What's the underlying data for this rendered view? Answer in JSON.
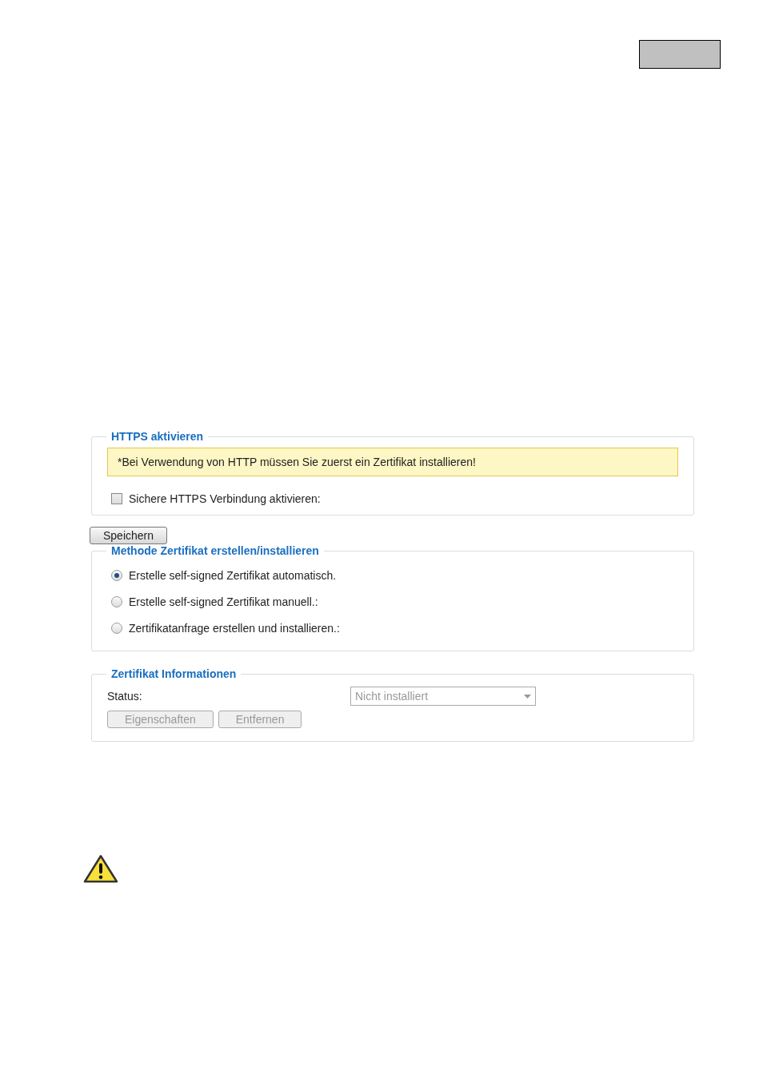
{
  "https_section": {
    "title": "HTTPS aktivieren",
    "notice": "*Bei Verwendung von HTTP müssen Sie zuerst ein Zertifikat installieren!",
    "checkbox": {
      "label": "Sichere HTTPS Verbindung aktivieren:",
      "checked": false
    }
  },
  "save_button": {
    "label": "Speichern",
    "disabled": false
  },
  "method_section": {
    "title": "Methode Zertifikat erstellen/installieren",
    "options": [
      {
        "label": "Erstelle self-signed Zertifikat automatisch.",
        "selected": true
      },
      {
        "label": "Erstelle self-signed Zertifikat manuell.:",
        "selected": false
      },
      {
        "label": "Zertifikatanfrage erstellen und installieren.:",
        "selected": false
      }
    ]
  },
  "info_section": {
    "title": "Zertifikat Informationen",
    "status_label": "Status:",
    "status_select": {
      "value": "Nicht installiert",
      "disabled": true
    },
    "buttons": [
      {
        "label": "Eigenschaften",
        "disabled": true
      },
      {
        "label": "Entfernen",
        "disabled": true
      }
    ]
  }
}
